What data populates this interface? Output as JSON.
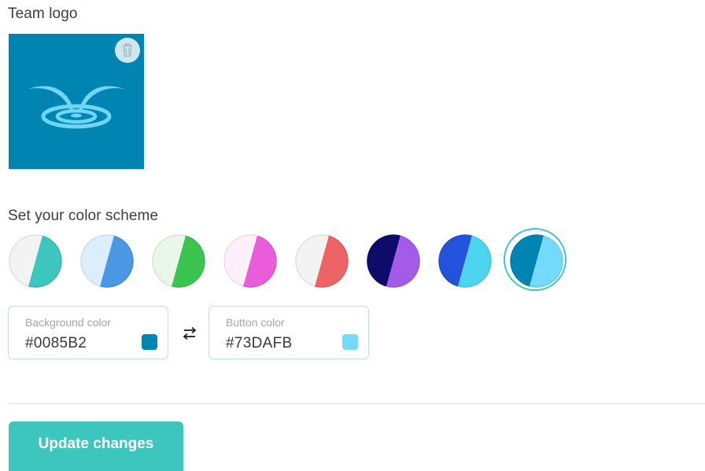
{
  "team_logo": {
    "label": "Team logo",
    "background": "#0085B2",
    "icon": "fountain-logo-icon",
    "delete_icon": "trash-icon"
  },
  "color_scheme": {
    "label": "Set your color scheme",
    "swatches": [
      {
        "background": "#F3F3F3",
        "button": "#3DC6BD",
        "selected": false
      },
      {
        "background": "#DCEEFC",
        "button": "#4A98E3",
        "selected": false
      },
      {
        "background": "#E8F7EA",
        "button": "#3CC450",
        "selected": false
      },
      {
        "background": "#FDF0FB",
        "button": "#EA5CD9",
        "selected": false
      },
      {
        "background": "#F3F3F3",
        "button": "#EC6464",
        "selected": false
      },
      {
        "background": "#0F0B6B",
        "button": "#A35BE8",
        "selected": false
      },
      {
        "background": "#2352DB",
        "button": "#4DD4EE",
        "selected": false
      },
      {
        "background": "#0085B2",
        "button": "#73DAFB",
        "selected": true
      }
    ],
    "selected_ring_color": "#3DC6BD"
  },
  "background_color": {
    "label": "Background color",
    "value": "#0085B2"
  },
  "button_color": {
    "label": "Button color",
    "value": "#73DAFB"
  },
  "swap_icon": "swap-arrows-icon",
  "update_button": {
    "label": "Update changes",
    "color": "#3DC6BD"
  }
}
